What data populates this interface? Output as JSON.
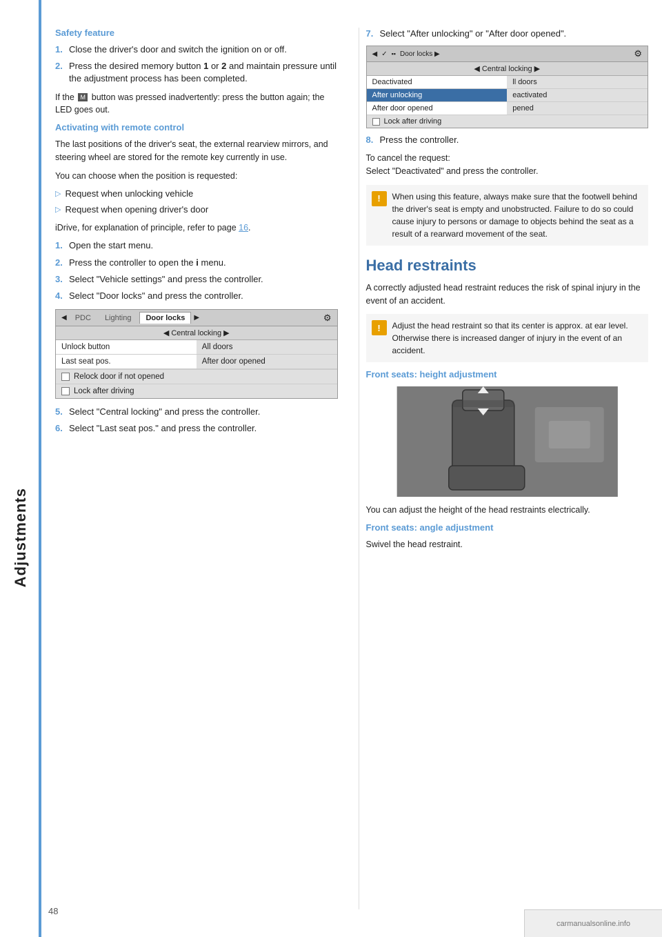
{
  "sidebar": {
    "label": "Adjustments"
  },
  "page_number": "48",
  "left_column": {
    "safety_feature": {
      "heading": "Safety feature",
      "steps": [
        {
          "num": "1.",
          "text": "Close the driver's door and switch the ignition on or off."
        },
        {
          "num": "2.",
          "text": "Press the desired memory button 1 or 2 and maintain pressure until the adjustment process has been completed."
        }
      ],
      "note_if": "If the",
      "note_mid": "button was pressed inadvertently: press the button again; the LED goes out."
    },
    "activating_remote": {
      "heading": "Activating with remote control",
      "para1": "The last positions of the driver's seat, the external rearview mirrors, and steering wheel are stored for the remote key currently in use.",
      "para2": "You can choose when the position is requested:",
      "bullets": [
        "Request when unlocking vehicle",
        "Request when opening driver's door"
      ],
      "idrive_note": "iDrive, for explanation of principle, refer to page",
      "page_ref": "16",
      "steps": [
        {
          "num": "1.",
          "text": "Open the start menu."
        },
        {
          "num": "2.",
          "text": "Press the controller to open the"
        },
        {
          "num": "2_suffix",
          "text": "menu."
        },
        {
          "num": "3.",
          "text": "Select \"Vehicle settings\" and press the controller."
        },
        {
          "num": "4.",
          "text": "Select \"Door locks\" and press the controller."
        }
      ],
      "idrive_menu": {
        "top_items": [
          "PDC",
          "Lighting",
          "Door locks"
        ],
        "subtitle": "Central locking",
        "rows": [
          {
            "col1": "Unlock button",
            "col2": "All doors"
          },
          {
            "col1": "Last seat pos.",
            "col2": "After door opened"
          }
        ],
        "checkbox_rows": [
          "Relock door if not opened",
          "Lock after driving"
        ]
      },
      "steps2": [
        {
          "num": "5.",
          "text": "Select \"Central locking\" and press the controller."
        },
        {
          "num": "6.",
          "text": "Select \"Last seat pos.\" and press the controller."
        }
      ]
    }
  },
  "right_column": {
    "step7": {
      "num": "7.",
      "text": "Select \"After unlocking\" or \"After door opened\"."
    },
    "idrive_menu2": {
      "top_items": [
        "Door locks"
      ],
      "subtitle": "Central locking",
      "rows": [
        {
          "col1": "Deactivated",
          "col2": "ll doors"
        },
        {
          "col1": "After unlocking",
          "col2": "eactivated",
          "col1_hl": true
        },
        {
          "col1": "After door opened",
          "col2": "pened"
        }
      ],
      "checkbox_rows": [
        "Lock after driving"
      ]
    },
    "step8": {
      "num": "8.",
      "text": "Press the controller."
    },
    "cancel_note": "To cancel the request:",
    "cancel_action": "Select \"Deactivated\" and press the controller.",
    "warning": {
      "text": "When using this feature, always make sure that the footwell behind the driver's seat is empty and unobstructed. Failure to do so could cause injury to persons or damage to objects behind the seat as a result of a rearward movement of the seat."
    },
    "head_restraints": {
      "heading": "Head restraints",
      "para": "A correctly adjusted head restraint reduces the risk of spinal injury in the event of an accident.",
      "warning": {
        "text": "Adjust the head restraint so that its center is approx. at ear level. Otherwise there is increased danger of injury in the event of an accident."
      },
      "front_seats_height": {
        "heading": "Front seats: height adjustment",
        "image_alt": "Seat head restraint height adjustment diagram",
        "para": "You can adjust the height of the head restraints electrically."
      },
      "front_seats_angle": {
        "heading": "Front seats: angle adjustment",
        "para": "Swivel the head restraint."
      }
    }
  },
  "watermark": "carmanualsonline.info"
}
